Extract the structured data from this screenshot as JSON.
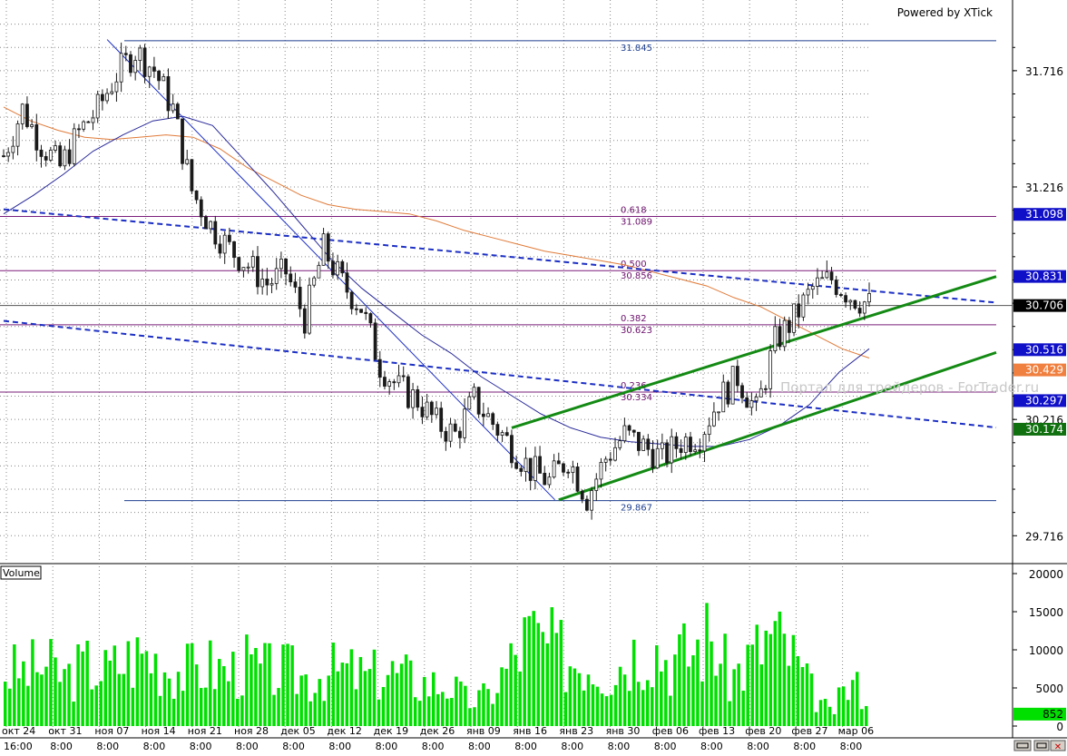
{
  "branding": "Powered by XTick",
  "watermark": "Портал для трейдеров - ForTrader.ru",
  "volume_label": "Volume",
  "colors": {
    "candle": "#1a1a1a",
    "fib": "#7a1f7a",
    "fib_text": "#6a106a",
    "trend_blue": "#1c2fc4",
    "ma_blue": "#2a2a9a",
    "ma_orange": "#e07b39",
    "channel_green": "#138a13",
    "extreme_line": "#1f3f8f",
    "volume_bar": "#00e000",
    "tag_blue": "#1010c8",
    "tag_black": "#000000",
    "tag_orange": "#f08040",
    "tag_green": "#107010"
  },
  "chart_data": [
    {
      "type": "candlestick",
      "title": "",
      "ylim": [
        29.6,
        32.02
      ],
      "y_ticks": [
        "31.716",
        "31.216",
        "30.716",
        "30.216",
        "29.716"
      ],
      "x_labels": [
        "окт 24",
        "окт 31",
        "ноя 07",
        "ноя 14",
        "ноя 21",
        "ноя 28",
        "дек 05",
        "дек 12",
        "дек 19",
        "дек 26",
        "янв 09",
        "янв 16",
        "янв 23",
        "янв 30",
        "фев 06",
        "фев 13",
        "фев 20",
        "фев 27",
        "мар 06"
      ],
      "x_time_labels": [
        "16:00",
        "8:00",
        "8:00",
        "8:00",
        "8:00",
        "8:00",
        "8:00",
        "8:00",
        "8:00",
        "8:00",
        "8:00",
        "8:00",
        "8:00",
        "8:00",
        "8:00",
        "8:00",
        "8:00",
        "8:00",
        "8:00"
      ],
      "close_path": [
        31.35,
        31.55,
        31.4,
        31.3,
        31.45,
        31.55,
        31.7,
        31.8,
        31.72,
        31.55,
        31.2,
        31.05,
        30.95,
        30.88,
        30.8,
        30.85,
        30.65,
        30.95,
        30.8,
        30.7,
        30.45,
        30.35,
        30.3,
        30.2,
        30.15,
        30.3,
        30.2,
        30.1,
        30.0,
        29.95,
        30.05,
        29.88,
        30.05,
        30.15,
        30.1,
        30.05,
        30.12,
        30.15,
        30.3,
        30.4,
        30.25,
        30.55,
        30.65,
        30.78,
        30.82,
        30.75,
        30.71
      ],
      "last_price": "30.706",
      "extremes": {
        "high": "31.845",
        "low": "29.867"
      },
      "fibonacci": [
        {
          "ratio": "0.618",
          "price": "31.089"
        },
        {
          "ratio": "0.500",
          "price": "30.856"
        },
        {
          "ratio": "0.382",
          "price": "30.623"
        },
        {
          "ratio": "0.236",
          "price": "30.334"
        }
      ],
      "price_tags": [
        {
          "price": "31.098",
          "color": "tag_blue",
          "value": 31.098
        },
        {
          "price": "30.831",
          "color": "tag_blue",
          "value": 30.831
        },
        {
          "price": "30.706",
          "color": "tag_black",
          "value": 30.706
        },
        {
          "price": "30.516",
          "color": "tag_blue",
          "value": 30.516
        },
        {
          "price": "30.429",
          "color": "tag_orange",
          "value": 30.429
        },
        {
          "price": "30.297",
          "color": "tag_blue",
          "value": 30.297
        },
        {
          "price": "30.174",
          "color": "tag_green",
          "value": 30.174
        }
      ],
      "trendlines": [
        {
          "name": "",
          "style": "dashed",
          "color": "trend_blue",
          "points": [
            [
              0,
              31.12
            ],
            [
              46,
              30.77
            ]
          ]
        },
        {
          "name": "",
          "style": "dashed",
          "color": "trend_blue",
          "points": [
            [
              0,
              30.64
            ],
            [
              46,
              30.24
            ]
          ]
        },
        {
          "name": "",
          "style": "solid",
          "color": "channel_green",
          "points": [
            [
              27,
              30.18
            ],
            [
              46,
              30.66
            ]
          ]
        },
        {
          "name": "",
          "style": "solid",
          "color": "channel_green",
          "points": [
            [
              29.5,
              29.87
            ],
            [
              46,
              30.32
            ]
          ]
        },
        {
          "name": "",
          "style": "solid",
          "color": "trend_blue",
          "points": [
            [
              5.5,
              31.85
            ],
            [
              29.3,
              29.87
            ]
          ]
        }
      ],
      "moving_averages": [
        {
          "name": "",
          "color": "ma_orange",
          "values": [
            31.56,
            31.5,
            31.46,
            31.43,
            31.42,
            31.43,
            31.44,
            31.43,
            31.38,
            31.3,
            31.24,
            31.18,
            31.14,
            31.12,
            31.11,
            31.1,
            31.07,
            31.03,
            31.0,
            30.97,
            30.94,
            30.92,
            30.9,
            30.88,
            30.85,
            30.82,
            30.79,
            30.74,
            30.7,
            30.64,
            30.58,
            30.52,
            30.48
          ]
        },
        {
          "name": "",
          "color": "ma_blue",
          "values": [
            31.1,
            31.18,
            31.27,
            31.37,
            31.44,
            31.5,
            31.52,
            31.48,
            31.34,
            31.2,
            31.05,
            30.9,
            30.78,
            30.68,
            30.58,
            30.5,
            30.4,
            30.32,
            30.24,
            30.18,
            30.14,
            30.12,
            30.11,
            30.1,
            30.1,
            30.13,
            30.19,
            30.28,
            30.42,
            30.52
          ]
        }
      ]
    },
    {
      "type": "bar",
      "title": "Volume",
      "ylim": [
        0,
        20000
      ],
      "y_ticks": [
        "20000",
        "15000",
        "10000",
        "5000",
        "0"
      ],
      "last_volume": "852",
      "volume_profile": [
        9,
        9,
        10,
        8,
        10,
        9,
        11,
        12,
        10,
        9,
        10,
        9,
        10,
        9,
        9,
        8,
        9,
        9,
        8,
        9,
        8,
        7,
        7,
        4,
        5,
        10,
        15,
        13,
        11,
        11,
        9,
        12,
        14,
        11,
        12,
        15,
        8,
        11,
        15,
        12,
        6,
        2,
        7,
        5
      ]
    }
  ]
}
